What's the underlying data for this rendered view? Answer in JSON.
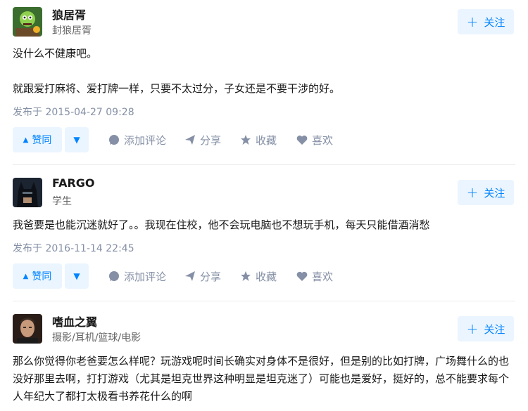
{
  "answers": [
    {
      "author": "狼居胥",
      "headline": "封狼居胥",
      "follow_label": "关注",
      "content": [
        "没什么不健康吧。",
        "就跟爱打麻将、爱打牌一样，只要不太过分，子女还是不要干涉的好。"
      ],
      "date": "发布于 2015-04-27 09:28",
      "upvote_label": "赞同",
      "comment_label": "添加评论",
      "share_label": "分享",
      "collect_label": "收藏",
      "like_label": "喜欢"
    },
    {
      "author": "FARGO",
      "headline": "学生",
      "follow_label": "关注",
      "content": [
        "我爸要是也能沉迷就好了。。我现在住校，他不会玩电脑也不想玩手机，每天只能借酒消愁"
      ],
      "date": "发布于 2016-11-14 22:45",
      "upvote_label": "赞同",
      "comment_label": "添加评论",
      "share_label": "分享",
      "collect_label": "收藏",
      "like_label": "喜欢"
    },
    {
      "author": "嗜血之翼",
      "headline": "摄影/耳机/篮球/电影",
      "follow_label": "关注",
      "content": [
        "那么你觉得你老爸要怎么样呢？玩游戏呢时间长确实对身体不是很好，但是别的比如打牌，广场舞什么的也没好那里去啊，打打游戏（尤其是坦克世界这种明显是坦克迷了）可能也是爱好，挺好的，总不能要求每个人年纪大了都打太极看书养花什么的啊"
      ]
    }
  ],
  "icons": {
    "upvote": "triangle-up-icon",
    "downvote": "triangle-down-icon",
    "comment": "comment-bubble-icon",
    "share": "paper-plane-icon",
    "collect": "star-icon",
    "like": "heart-icon",
    "follow": "plus-icon"
  },
  "colors": {
    "accent": "#0084ff",
    "accent_bg": "#ebf5ff",
    "muted": "#8590a6"
  }
}
